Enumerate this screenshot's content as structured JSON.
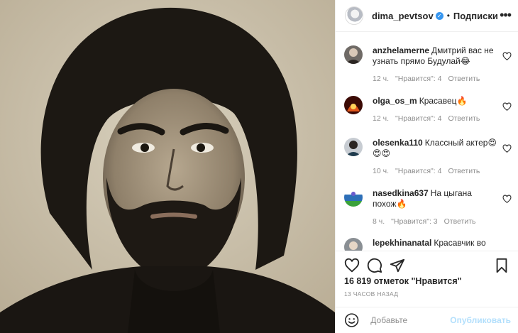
{
  "post": {
    "username": "dima_pevtsov",
    "follow_label": "Подписки",
    "separator": "•"
  },
  "comments": [
    {
      "user": "anzhelamerne",
      "text": "Дмитрий вас не узнать прямо Будулай😂",
      "time": "12 ч.",
      "likes": "\"Нравится\": 4",
      "reply": "Ответить"
    },
    {
      "user": "olga_os_m",
      "text": "Красавец🔥",
      "time": "12 ч.",
      "likes": "\"Нравится\": 4",
      "reply": "Ответить"
    },
    {
      "user": "olesenka110",
      "text": "Классный актер😍😍😍",
      "time": "10 ч.",
      "likes": "\"Нравится\": 4",
      "reply": "Ответить"
    },
    {
      "user": "nasedkina637",
      "text": "На цыгана похож🔥",
      "time": "8 ч.",
      "likes": "\"Нравится\": 3",
      "reply": "Ответить"
    },
    {
      "user": "lepekhinanatal",
      "text": "Красавчик во все"
    }
  ],
  "likes_count": "16 819 отметок \"Нравится\"",
  "timestamp": "13 ЧАСОВ НАЗАД",
  "add_comment": {
    "placeholder": "Добавьте",
    "publish_label": "Опубликовать"
  },
  "colors": {
    "accent": "#3897f0",
    "publish_disabled": "#b2dffc",
    "muted": "#8e8e8e"
  }
}
